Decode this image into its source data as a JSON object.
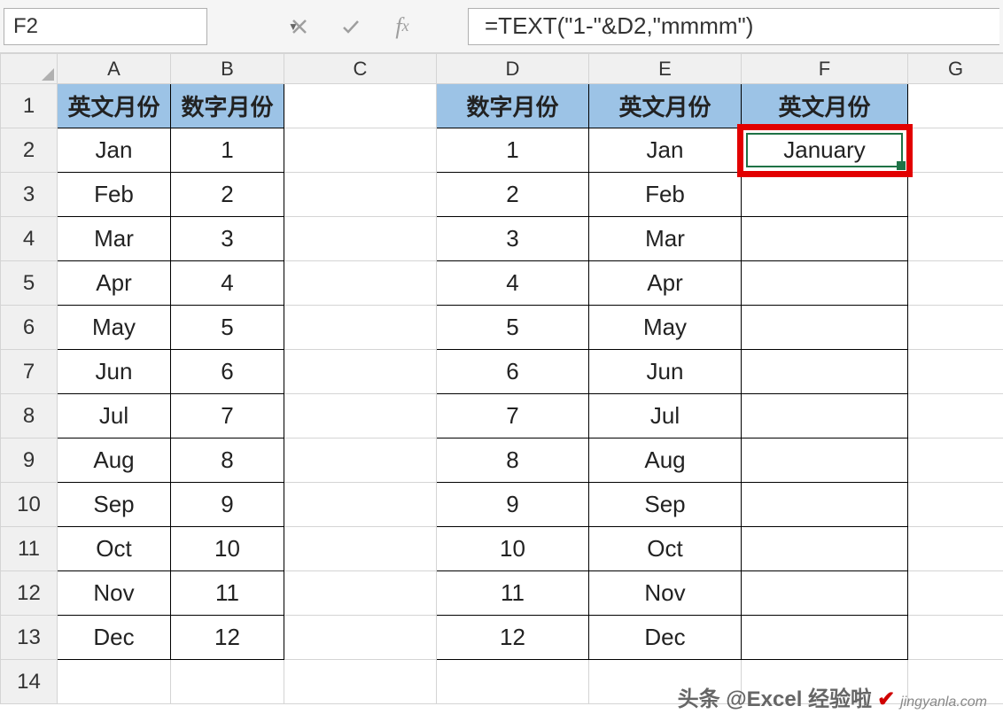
{
  "formulaBar": {
    "cellRef": "F2",
    "formula": "=TEXT(\"1-\"&D2,\"mmmm\")"
  },
  "columns": [
    "A",
    "B",
    "C",
    "D",
    "E",
    "F",
    "G"
  ],
  "rows": [
    "1",
    "2",
    "3",
    "4",
    "5",
    "6",
    "7",
    "8",
    "9",
    "10",
    "11",
    "12",
    "13",
    "14"
  ],
  "headers": {
    "a1": "英文月份",
    "b1": "数字月份",
    "d1": "数字月份",
    "e1": "英文月份",
    "f1": "英文月份"
  },
  "tableLeft": [
    {
      "a": "Jan",
      "b": "1"
    },
    {
      "a": "Feb",
      "b": "2"
    },
    {
      "a": "Mar",
      "b": "3"
    },
    {
      "a": "Apr",
      "b": "4"
    },
    {
      "a": "May",
      "b": "5"
    },
    {
      "a": "Jun",
      "b": "6"
    },
    {
      "a": "Jul",
      "b": "7"
    },
    {
      "a": "Aug",
      "b": "8"
    },
    {
      "a": "Sep",
      "b": "9"
    },
    {
      "a": "Oct",
      "b": "10"
    },
    {
      "a": "Nov",
      "b": "11"
    },
    {
      "a": "Dec",
      "b": "12"
    }
  ],
  "tableRight": [
    {
      "d": "1",
      "e": "Jan",
      "f": "January"
    },
    {
      "d": "2",
      "e": "Feb",
      "f": ""
    },
    {
      "d": "3",
      "e": "Mar",
      "f": ""
    },
    {
      "d": "4",
      "e": "Apr",
      "f": ""
    },
    {
      "d": "5",
      "e": "May",
      "f": ""
    },
    {
      "d": "6",
      "e": "Jun",
      "f": ""
    },
    {
      "d": "7",
      "e": "Jul",
      "f": ""
    },
    {
      "d": "8",
      "e": "Aug",
      "f": ""
    },
    {
      "d": "9",
      "e": "Sep",
      "f": ""
    },
    {
      "d": "10",
      "e": "Oct",
      "f": ""
    },
    {
      "d": "11",
      "e": "Nov",
      "f": ""
    },
    {
      "d": "12",
      "e": "Dec",
      "f": ""
    }
  ],
  "watermark": {
    "text": "头条 @Excel 经验啦",
    "sub": "jingyanla.com"
  }
}
